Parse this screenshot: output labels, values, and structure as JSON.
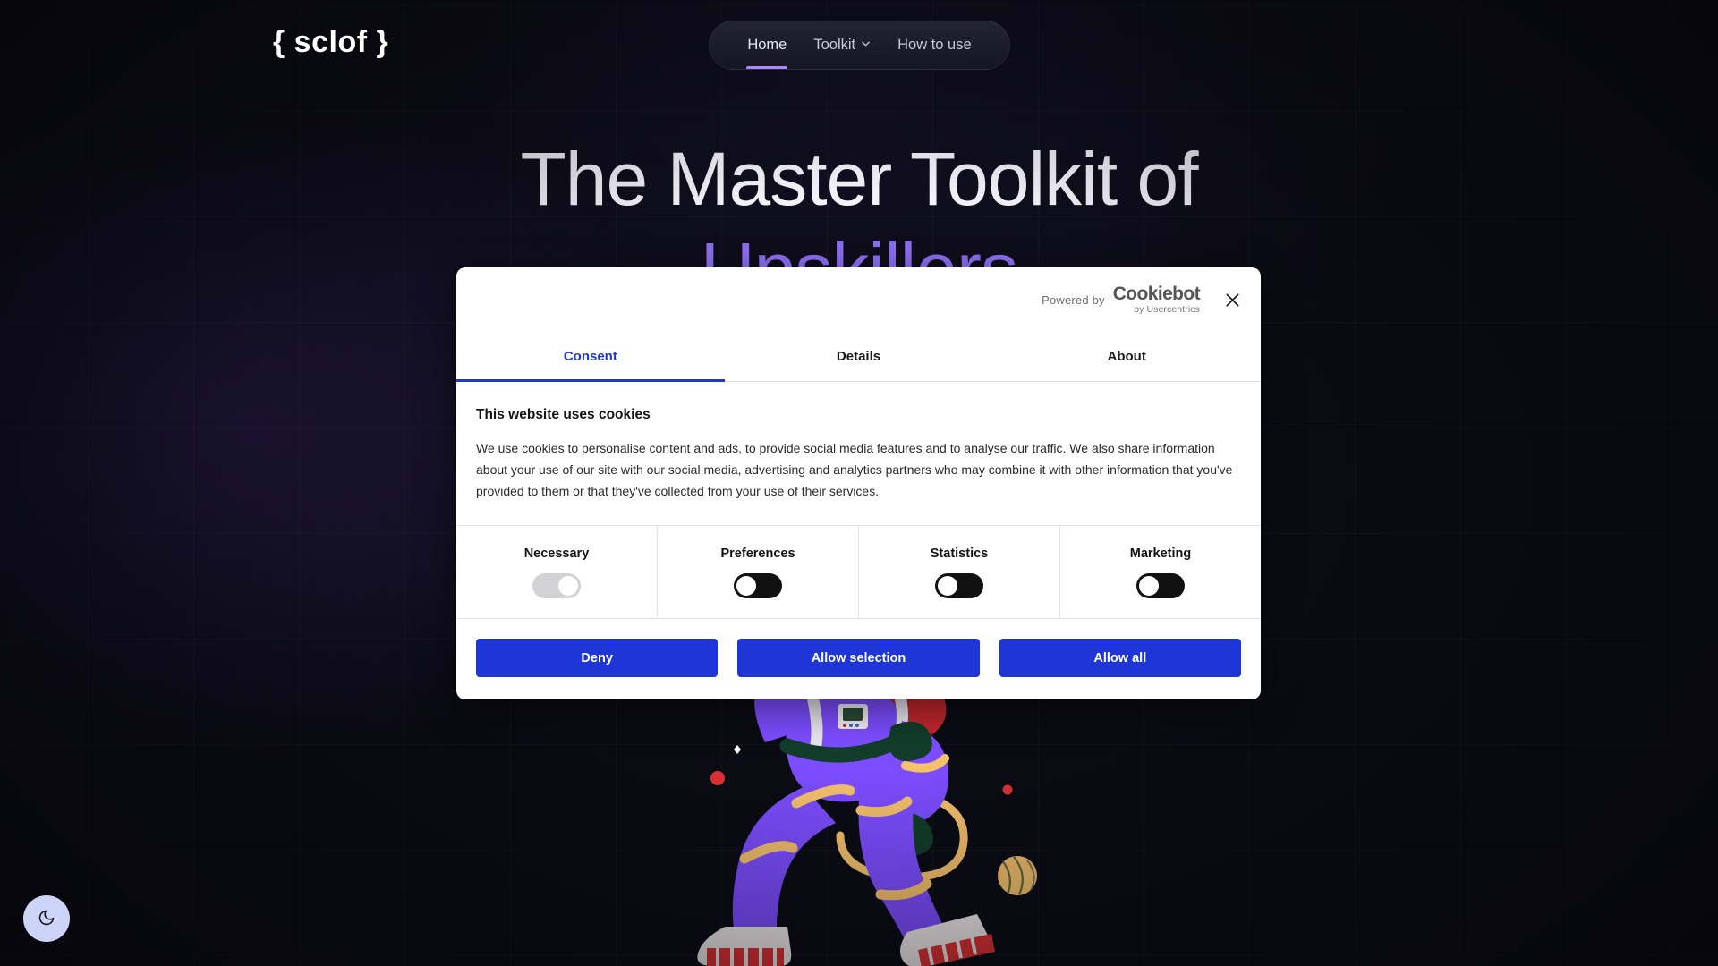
{
  "site": {
    "logo": "{ sclof }",
    "nav": [
      {
        "label": "Home",
        "icon": "",
        "active": true
      },
      {
        "label": "Toolkit",
        "icon": "chevron-down-icon",
        "active": false
      },
      {
        "label": "How to use",
        "icon": "",
        "active": false
      }
    ]
  },
  "hero": {
    "line1": "The Master Toolkit of",
    "line2": "Upskillers",
    "accent_color": "#8b6ef0"
  },
  "theme_toggle": {
    "icon": "moon-icon",
    "background": "#ccd5f7"
  },
  "cookie_dialog": {
    "powered_by_label": "Powered by",
    "brand_name": "Cookiebot",
    "brand_subtitle": "by Usercentrics",
    "close_icon": "close-icon",
    "tabs": [
      {
        "label": "Consent",
        "active": true
      },
      {
        "label": "Details",
        "active": false
      },
      {
        "label": "About",
        "active": false
      }
    ],
    "title": "This website uses cookies",
    "description": "We use cookies to personalise content and ads, to provide social media features and to analyse our traffic. We also share information about your use of our site with our social media, advertising and analytics partners who may combine it with other information that you've provided to them or that they've collected from your use of their services.",
    "consents": [
      {
        "label": "Necessary",
        "state": "locked"
      },
      {
        "label": "Preferences",
        "state": "off"
      },
      {
        "label": "Statistics",
        "state": "off"
      },
      {
        "label": "Marketing",
        "state": "off"
      }
    ],
    "buttons": [
      {
        "label": "Deny"
      },
      {
        "label": "Allow selection"
      },
      {
        "label": "Allow all"
      }
    ],
    "accent_color": "#1f36d6"
  },
  "illustration": {
    "name": "astronaut-illustration",
    "suit_color": "#7c4dff",
    "band_color": "#f5c16c",
    "glove_color": "#123d2a",
    "boot_color": "#f3eeee",
    "boot_accent": "#e03232",
    "helmet_color": "#c0272d",
    "planet_color": "#f5c16c"
  }
}
